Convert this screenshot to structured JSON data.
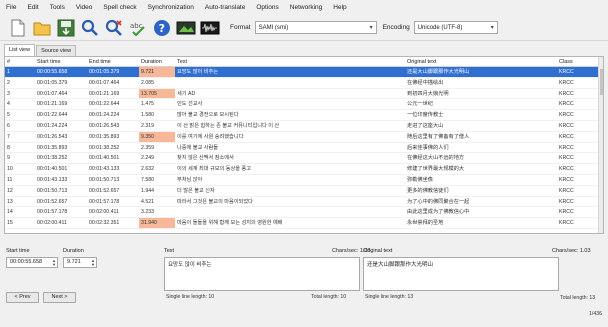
{
  "menu": [
    "File",
    "Edit",
    "Tools",
    "Video",
    "Spell check",
    "Synchronization",
    "Auto-translate",
    "Options",
    "Networking",
    "Help"
  ],
  "toolbar": {
    "format_label": "Format",
    "format_value": "SAMI (smi)",
    "encoding_label": "Encoding",
    "encoding_value": "Unicode (UTF-8)",
    "icons": [
      "new-file-icon",
      "open-folder-icon",
      "save-icon",
      "find-icon",
      "replace-icon",
      "spell-check-icon",
      "help-icon",
      "video-icon",
      "waveform-icon"
    ]
  },
  "tabs": [
    "List view",
    "Source view"
  ],
  "columns": [
    "#",
    "Start time",
    "End time",
    "Duration",
    "Text",
    "Original text",
    "Class"
  ],
  "rows": [
    {
      "num": "1",
      "start": "00:00:55.658",
      "end": "00:01:05.379",
      "dur": "9.721",
      "text": "요망도 많이 비추는",
      "orig": "还是大山脚跟那作大光明山",
      "cls": "KRCC",
      "hl": true,
      "selected": true
    },
    {
      "num": "2",
      "start": "00:01:05.379",
      "end": "00:01:07.464",
      "dur": "2.085",
      "text": "",
      "orig": "在佛经中描绘出",
      "cls": "KRCC",
      "hl": false,
      "selected": false
    },
    {
      "num": "3",
      "start": "00:01:07.464",
      "end": "00:01:21.169",
      "dur": "13.705",
      "text": "세기 AD",
      "orig": "到初四月大娘光明",
      "cls": "KRCC",
      "hl": true,
      "selected": false
    },
    {
      "num": "4",
      "start": "00:01:21.169",
      "end": "00:01:22.644",
      "dur": "1.475",
      "text": "인도 선교사",
      "orig": "公元一世纪",
      "cls": "KRCC",
      "hl": false,
      "selected": false
    },
    {
      "num": "5",
      "start": "00:01:22.644",
      "end": "00:01:24.224",
      "dur": "1.580",
      "text": "많아 불교 경전으로 모시된다",
      "orig": "一位印度传教士",
      "cls": "KRCC",
      "hl": false,
      "selected": false
    },
    {
      "num": "6",
      "start": "00:01:24.224",
      "end": "00:01:26.543",
      "dur": "2.319",
      "text": "이 산 밝은 힘하는 존 불교 커뮤니티입니다 이 산",
      "orig": "走进了这座大山",
      "cls": "KRCC",
      "hl": false,
      "selected": false
    },
    {
      "num": "7",
      "start": "00:01:26.543",
      "end": "00:01:35.893",
      "dur": "9.350",
      "text": "이를 여기에 사원 승려했습니다",
      "orig": "随后这里有了佛备有了僧人",
      "cls": "KRCC",
      "hl": true,
      "selected": false
    },
    {
      "num": "8",
      "start": "00:01:35.893",
      "end": "00:01:38.252",
      "dur": "2.359",
      "text": "나중에 불교 사람들",
      "orig": "后来佳事佛的人们",
      "cls": "KRCC",
      "hl": false,
      "selected": false
    },
    {
      "num": "9",
      "start": "00:01:38.252",
      "end": "00:01:40.501",
      "dur": "2.249",
      "text": "찾지 않은 산맥서 참소에서",
      "orig": "在佛经这大山不远的地方",
      "cls": "KRCC",
      "hl": false,
      "selected": false
    },
    {
      "num": "10",
      "start": "00:01:40.501",
      "end": "00:01:43.133",
      "dur": "2.632",
      "text": "이의 세계 최대 규모의 동상을 풍고",
      "orig": "修建了世界最大规模的大",
      "cls": "KRCC",
      "hl": false,
      "selected": false
    },
    {
      "num": "11",
      "start": "00:01:43.133",
      "end": "00:01:50.713",
      "dur": "7.580",
      "text": "부처님 앉아",
      "orig": "弥勒佛坐像",
      "cls": "KRCC",
      "hl": false,
      "selected": false
    },
    {
      "num": "12",
      "start": "00:01:50.713",
      "end": "00:01:52.657",
      "dur": "1.944",
      "text": "더 많은 불교 신자",
      "orig": "更多的佛教信徒们",
      "cls": "KRCC",
      "hl": false,
      "selected": false
    },
    {
      "num": "13",
      "start": "00:01:52.657",
      "end": "00:01:57.178",
      "dur": "4.521",
      "text": "따라서 그것은 불교의 마음이되었다",
      "orig": "为了心中的佛同聚合在一起",
      "cls": "KRCC",
      "hl": false,
      "selected": false
    },
    {
      "num": "14",
      "start": "00:01:57.178",
      "end": "00:02:00.411",
      "dur": "3.233",
      "text": "",
      "orig": "由此这里成为了佛教信心中",
      "cls": "KRCC",
      "hl": false,
      "selected": false
    },
    {
      "num": "15",
      "start": "00:02:00.411",
      "end": "00:02:32.351",
      "dur": "31.940",
      "text": "마음이 돌들을 위해 함께 모는 성지의 영원한 예배",
      "orig": "永世崇拜的圣地",
      "cls": "KRCC",
      "hl": true,
      "selected": false
    }
  ],
  "editor": {
    "start_label": "Start time",
    "duration_label": "Duration",
    "start_value": "00:00:55.658",
    "duration_value": "9.721",
    "text_label": "Text",
    "chars_sec_1": "Chars/sec: 1.03",
    "orig_label": "Original text",
    "chars_sec_2": "Chars/sec: 1.03",
    "text_value": "요망도 많이 비추는",
    "orig_value": "还是大山脚跟那作大光明山",
    "prev": "< Prev",
    "next": "Next >",
    "single_line_1": "Single line length: 10",
    "total_1": "Total length: 10",
    "single_line_2": "Single line length: 13",
    "total_2": "Total length: 13",
    "counter": "1/436"
  },
  "colors": {
    "selection": "#2f6fd2",
    "duration_highlight": "#f6b899"
  }
}
